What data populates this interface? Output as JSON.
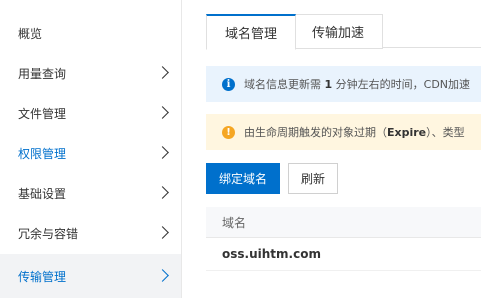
{
  "sidebar": {
    "items": [
      {
        "label": "概览",
        "chevron": false
      },
      {
        "label": "用量查询",
        "chevron": true
      },
      {
        "label": "文件管理",
        "chevron": true
      },
      {
        "label": "权限管理",
        "chevron": true
      },
      {
        "label": "基础设置",
        "chevron": true
      },
      {
        "label": "冗余与容错",
        "chevron": true
      },
      {
        "label": "传输管理",
        "chevron": true,
        "active": true
      }
    ]
  },
  "tabs": [
    {
      "label": "域名管理",
      "active": true
    },
    {
      "label": "传输加速",
      "active": false
    }
  ],
  "info_banner": {
    "icon": "info-icon",
    "text_before": "域名信息更新需 ",
    "text_bold": "1",
    "text_after": " 分钟左右的时间，CDN加速"
  },
  "warn_banner": {
    "icon": "warning-icon",
    "text_before": "由生命周期触发的对象过期（",
    "text_bold": "Expire",
    "text_after": "）、类型"
  },
  "toolbar": {
    "bind_domain_label": "绑定域名",
    "refresh_label": "刷新"
  },
  "table": {
    "column_header": "域名",
    "rows": [
      "oss.uihtm.com"
    ]
  },
  "colors": {
    "accent": "#0070cc",
    "info_bg": "#e9f3fd",
    "warn_bg": "#fff6e0",
    "warn_icon": "#f5a623"
  }
}
